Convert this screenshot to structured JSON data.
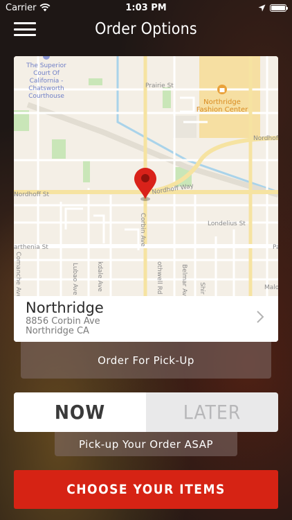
{
  "status_bar": {
    "carrier": "Carrier",
    "time": "1:03 PM",
    "battery_level": 1.0
  },
  "header": {
    "title": "Order Options"
  },
  "map": {
    "labels": {
      "poi_court": [
        "The Superior",
        "Court Of",
        "California -",
        "Chatsworth",
        "Courthouse"
      ],
      "poi_mall": [
        "Northridge",
        "Fashion Center"
      ],
      "prairie_st": "Prairie St",
      "nordhoff_st_left": "Nordhoff St",
      "nordhoff_way": "Nordhoff Way",
      "nordhoff_right": "Nordhoff",
      "corbin_ave": "Corbin Ave",
      "londelius_st": "Londelius St",
      "parthenia_st": "arthenia St",
      "comanche_ave": "Comanche Ave",
      "lubao_ave": "Lubao Ave",
      "lindley_ave": "kdale Ave",
      "rothwell_rd": "othwell Rd",
      "belmar_ave": "Belmar Ave",
      "shirley": "Shir",
      "malo": "Malo",
      "pa": "Pa"
    },
    "colors": {
      "background": "#f4efe6",
      "road": "#ffffff",
      "major_road": "#fbe7a6",
      "park": "#c9e6b8",
      "mall": "#f6dfa2",
      "poi_icon": "#e9a23b",
      "water": "#a9d3ea",
      "pin": "#d9221a"
    }
  },
  "location": {
    "name": "Northridge",
    "address_line1": "8856 Corbin Ave",
    "address_line2": "Northridge CA",
    "chevron": "chevron-right-icon"
  },
  "order_type": {
    "label": "Order For Pick-Up"
  },
  "timing": {
    "now_label": "NOW",
    "later_label": "LATER",
    "selected": "NOW",
    "asap_label": "Pick-up Your Order ASAP"
  },
  "cta": {
    "label": "CHOOSE YOUR ITEMS",
    "color": "#d62314"
  }
}
